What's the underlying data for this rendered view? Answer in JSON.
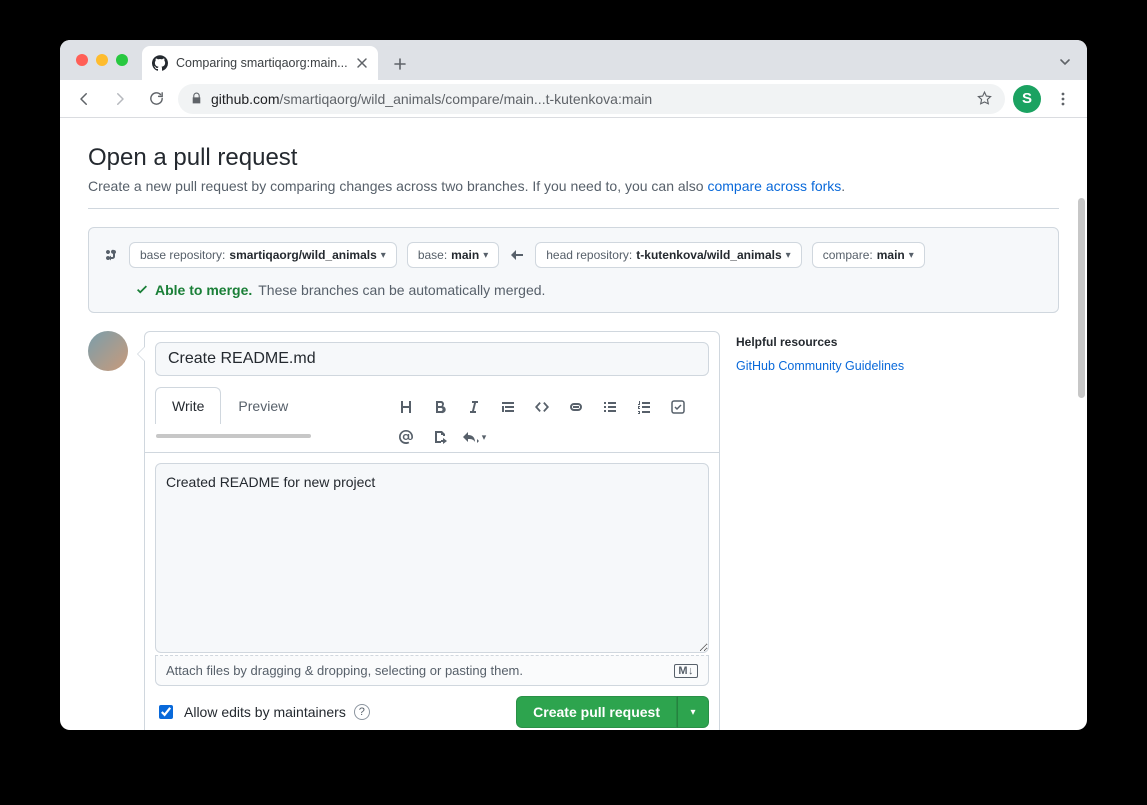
{
  "browser": {
    "tab_title": "Comparing smartiqaorg:main...",
    "url_host": "github.com",
    "url_path": "/smartiqaorg/wild_animals/compare/main...t-kutenkova:main",
    "profile_initial": "S"
  },
  "page": {
    "heading": "Open a pull request",
    "subtitle_pre": "Create a new pull request by comparing changes across two branches. If you need to, you can also ",
    "subtitle_link": "compare across forks",
    "subtitle_post": "."
  },
  "compare": {
    "base_repo_label": "base repository: ",
    "base_repo_value": "smartiqaorg/wild_animals",
    "base_label": "base: ",
    "base_value": "main",
    "head_repo_label": "head repository: ",
    "head_repo_value": "t-kutenkova/wild_animals",
    "compare_label": "compare: ",
    "compare_value": "main",
    "merge_status": "Able to merge.",
    "merge_info": "These branches can be automatically merged."
  },
  "form": {
    "title_value": "Create README.md",
    "tab_write": "Write",
    "tab_preview": "Preview",
    "body_value": "Created README for new project",
    "attach_text": "Attach files by dragging & dropping, selecting or pasting them.",
    "allow_edits_label": "Allow edits by maintainers",
    "submit_label": "Create pull request",
    "md_badge": "M↓"
  },
  "sidebar": {
    "helpful_heading": "Helpful resources",
    "guidelines_link": "GitHub Community Guidelines"
  }
}
